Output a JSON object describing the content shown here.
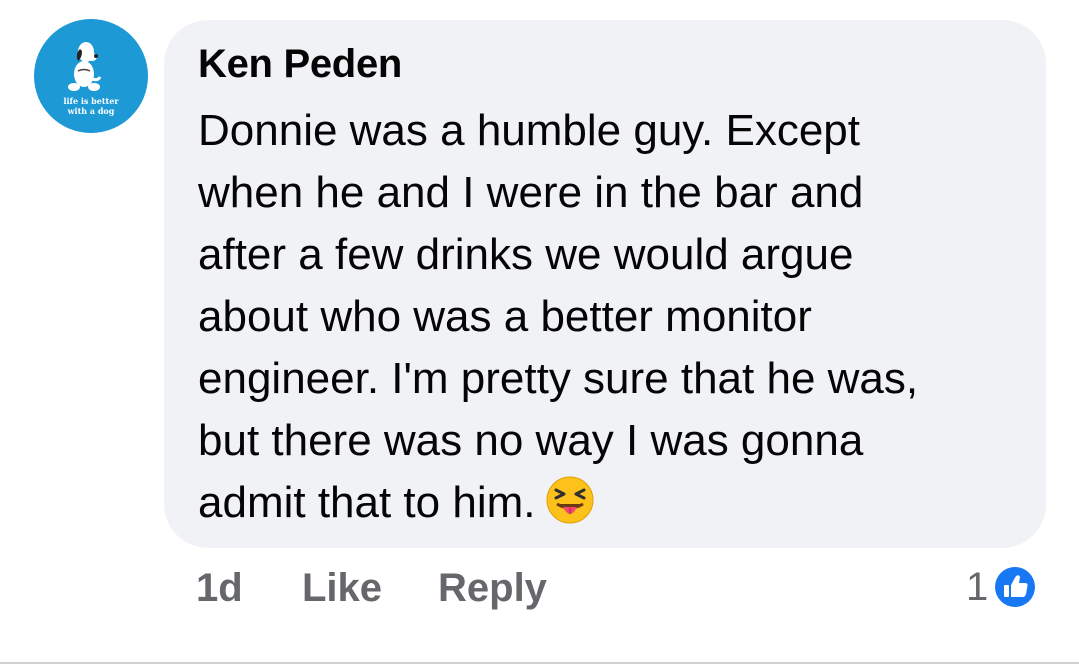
{
  "comment": {
    "author": "Ken Peden",
    "avatar_text": [
      "life is better",
      "with a dog"
    ],
    "lines": [
      "Donnie was a humble guy. Except",
      "when he and I were in the bar and",
      "after a few drinks we would argue",
      "about who was a better monitor",
      "engineer. I'm pretty sure that he was,",
      "but there was no way I was gonna",
      "admit that to him."
    ],
    "emoji": "squinting-face-with-tongue-icon"
  },
  "actions": {
    "time": "1d",
    "like_label": "Like",
    "reply_label": "Reply"
  },
  "reactions": {
    "count": "1",
    "icon": "like-thumb-icon",
    "color": "#1877f2"
  },
  "colors": {
    "bubble": "#f0f2f5",
    "avatar_bg": "#1d9ad6",
    "meta_text": "#65676b"
  }
}
